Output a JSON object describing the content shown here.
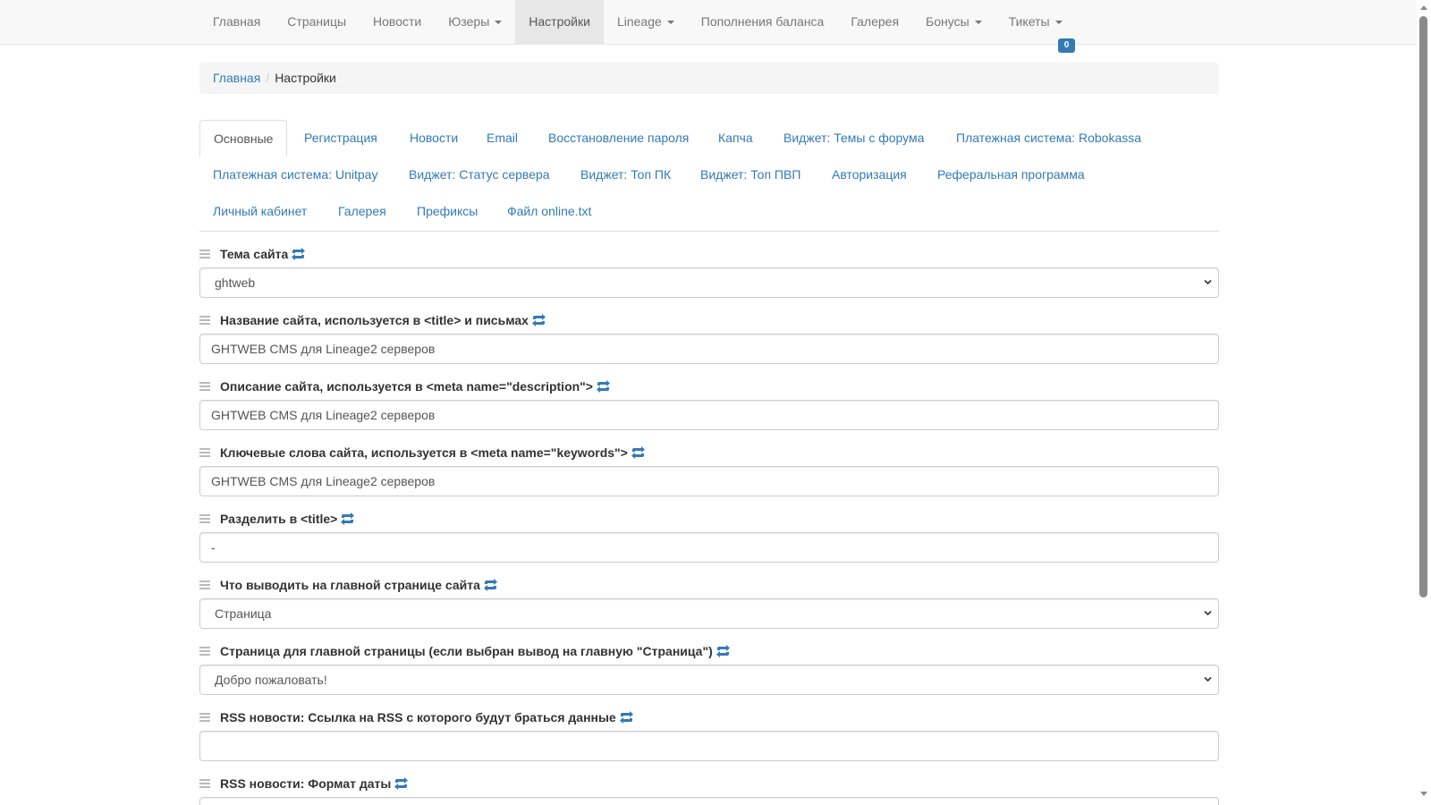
{
  "nav": {
    "items": [
      {
        "label": "Главная",
        "dropdown": false,
        "active": false
      },
      {
        "label": "Страницы",
        "dropdown": false,
        "active": false
      },
      {
        "label": "Новости",
        "dropdown": false,
        "active": false
      },
      {
        "label": "Юзеры",
        "dropdown": true,
        "active": false
      },
      {
        "label": "Настройки",
        "dropdown": false,
        "active": true
      },
      {
        "label": "Lineage",
        "dropdown": true,
        "active": false
      },
      {
        "label": "Пополнения баланса",
        "dropdown": false,
        "active": false
      },
      {
        "label": "Галерея",
        "dropdown": false,
        "active": false
      },
      {
        "label": "Бонусы",
        "dropdown": true,
        "active": false
      },
      {
        "label": "Тикеты",
        "dropdown": true,
        "active": false
      }
    ],
    "tickets_badge": "0"
  },
  "breadcrumb": {
    "home": "Главная",
    "separator": "/",
    "current": "Настройки"
  },
  "tabs": [
    {
      "label": "Основные",
      "active": true
    },
    {
      "label": "Регистрация"
    },
    {
      "label": "Новости"
    },
    {
      "label": "Email"
    },
    {
      "label": "Восстановление пароля"
    },
    {
      "label": "Капча"
    },
    {
      "label": "Виджет: Темы с форума"
    },
    {
      "label": "Платежная система: Robokassa"
    },
    {
      "label": "Платежная система: Unitpay"
    },
    {
      "label": "Виджет: Статус сервера"
    },
    {
      "label": "Виджет: Топ ПК"
    },
    {
      "label": "Виджет: Топ ПВП"
    },
    {
      "label": "Авторизация"
    },
    {
      "label": "Реферальная программа"
    },
    {
      "label": "Личный кабинет"
    },
    {
      "label": "Галерея"
    },
    {
      "label": "Префиксы"
    },
    {
      "label": "Файл online.txt"
    }
  ],
  "fields": [
    {
      "label": "Тема сайта",
      "type": "select",
      "value": "ghtweb"
    },
    {
      "label": "Название сайта, используется в <title> и письмах",
      "type": "input",
      "value": "GHTWEB CMS для Lineage2 серверов"
    },
    {
      "label": "Описание сайта, используется в <meta name=\"description\">",
      "type": "input",
      "value": "GHTWEB CMS для Lineage2 серверов"
    },
    {
      "label": "Ключевые слова сайта, используется в <meta name=\"keywords\">",
      "type": "input",
      "value": "GHTWEB CMS для Lineage2 серверов"
    },
    {
      "label": "Разделить в <title>",
      "type": "input",
      "value": "-"
    },
    {
      "label": "Что выводить на главной странице сайта",
      "type": "select",
      "value": "Страница"
    },
    {
      "label": "Страница для главной страницы (если выбран вывод на главную \"Страница\")",
      "type": "select",
      "value": "Добро пожаловать!"
    },
    {
      "label": "RSS новости: Ссылка на RSS с которого будут браться данные",
      "type": "input",
      "value": ""
    },
    {
      "label": "RSS новости: Формат даты",
      "type": "input",
      "value": ""
    }
  ],
  "colors": {
    "link": "#337ab7",
    "nav_bg": "#f8f8f8",
    "nav_active_bg": "#e7e7e7",
    "badge": "#337ab7"
  },
  "icons": {
    "reset": "refresh-icon",
    "drag": "drag-handle-icon",
    "dropdown": "caret-down-icon"
  }
}
